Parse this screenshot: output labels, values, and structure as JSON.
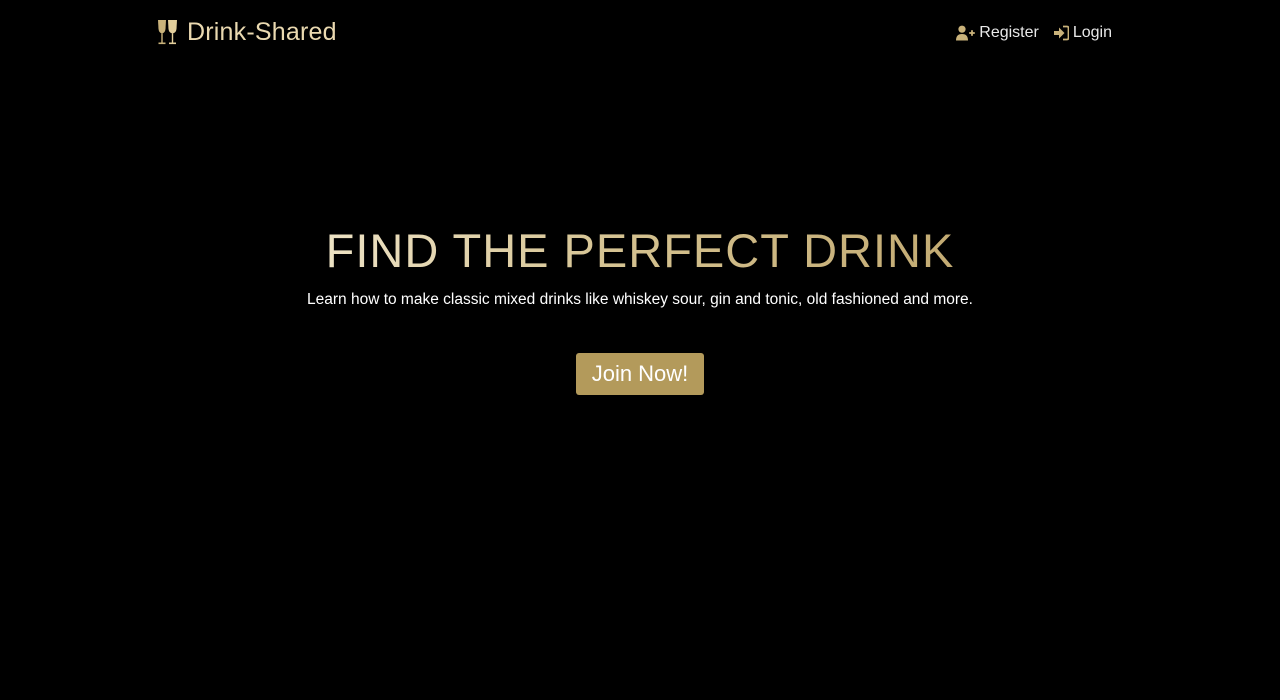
{
  "navbar": {
    "brand_text": "Drink-Shared",
    "brand_icon": "wine-glasses-icon",
    "links": [
      {
        "label": "Register",
        "icon": "user-plus-icon"
      },
      {
        "label": "Login",
        "icon": "sign-in-icon"
      }
    ]
  },
  "hero": {
    "title": "FIND THE PERFECT DRINK",
    "subtitle": "Learn how to make classic mixed drinks like whiskey sour, gin and tonic, old fashioned and more.",
    "cta_label": "Join Now!"
  },
  "colors": {
    "background": "#000000",
    "accent": "#b39a5b",
    "brand_text": "#ead9b0",
    "title_gradient_start": "#ede2c4",
    "title_gradient_end": "#c3ab73"
  }
}
